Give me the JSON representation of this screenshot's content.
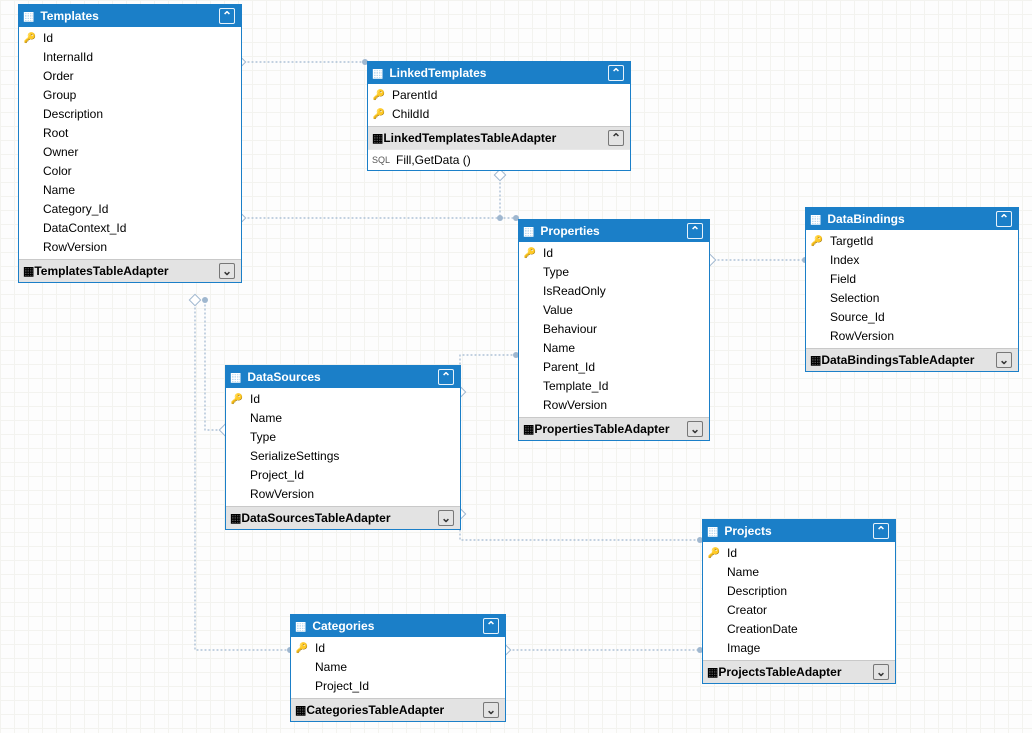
{
  "templates": {
    "title": "Templates",
    "adapter": "TemplatesTableAdapter",
    "columns": [
      {
        "name": "Id",
        "key": true
      },
      {
        "name": "InternalId"
      },
      {
        "name": "Order"
      },
      {
        "name": "Group"
      },
      {
        "name": "Description"
      },
      {
        "name": "Root"
      },
      {
        "name": "Owner"
      },
      {
        "name": "Color"
      },
      {
        "name": "Name"
      },
      {
        "name": "Category_Id"
      },
      {
        "name": "DataContext_Id"
      },
      {
        "name": "RowVersion"
      }
    ]
  },
  "linkedTemplates": {
    "title": "LinkedTemplates",
    "adapter": "LinkedTemplatesTableAdapter",
    "method": "Fill,GetData ()",
    "columns": [
      {
        "name": "ParentId",
        "key": true
      },
      {
        "name": "ChildId",
        "key": true
      }
    ]
  },
  "properties": {
    "title": "Properties",
    "adapter": "PropertiesTableAdapter",
    "columns": [
      {
        "name": "Id",
        "key": true
      },
      {
        "name": "Type"
      },
      {
        "name": "IsReadOnly"
      },
      {
        "name": "Value"
      },
      {
        "name": "Behaviour"
      },
      {
        "name": "Name"
      },
      {
        "name": "Parent_Id"
      },
      {
        "name": "Template_Id"
      },
      {
        "name": "RowVersion"
      }
    ]
  },
  "dataBindings": {
    "title": "DataBindings",
    "adapter": "DataBindingsTableAdapter",
    "columns": [
      {
        "name": "TargetId",
        "key": true
      },
      {
        "name": "Index"
      },
      {
        "name": "Field"
      },
      {
        "name": "Selection"
      },
      {
        "name": "Source_Id"
      },
      {
        "name": "RowVersion"
      }
    ]
  },
  "dataSources": {
    "title": "DataSources",
    "adapter": "DataSourcesTableAdapter",
    "columns": [
      {
        "name": "Id",
        "key": true
      },
      {
        "name": "Name"
      },
      {
        "name": "Type"
      },
      {
        "name": "SerializeSettings"
      },
      {
        "name": "Project_Id"
      },
      {
        "name": "RowVersion"
      }
    ]
  },
  "categories": {
    "title": "Categories",
    "adapter": "CategoriesTableAdapter",
    "columns": [
      {
        "name": "Id",
        "key": true
      },
      {
        "name": "Name"
      },
      {
        "name": "Project_Id"
      }
    ]
  },
  "projects": {
    "title": "Projects",
    "adapter": "ProjectsTableAdapter",
    "columns": [
      {
        "name": "Id",
        "key": true
      },
      {
        "name": "Name"
      },
      {
        "name": "Description"
      },
      {
        "name": "Creator"
      },
      {
        "name": "CreationDate"
      },
      {
        "name": "Image"
      }
    ]
  }
}
